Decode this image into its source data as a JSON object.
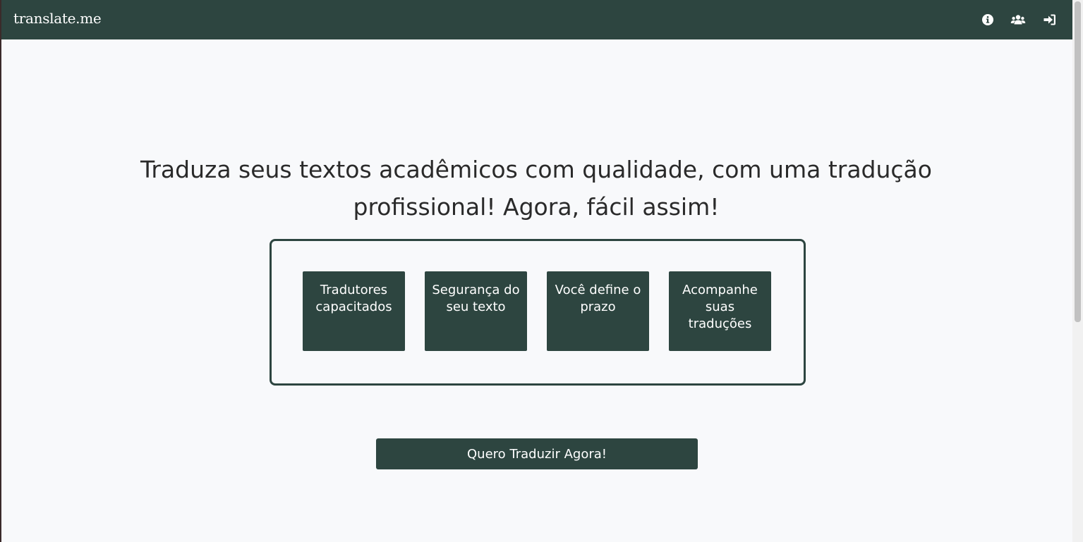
{
  "navbar": {
    "brand": "translate.me",
    "icons": [
      "info-icon",
      "users-icon",
      "sign-in-icon"
    ],
    "background": "#2d4540"
  },
  "hero": {
    "headline": "Traduza seus textos acadêmicos com qualidade, com uma tradução profissional! Agora, fácil assim!"
  },
  "features": [
    {
      "label": "Tradutores capacitados"
    },
    {
      "label": "Segurança do seu texto"
    },
    {
      "label": "Você define o prazo"
    },
    {
      "label": "Acompanhe suas traduções"
    }
  ],
  "cta": {
    "label": "Quero Traduzir Agora!"
  },
  "colors": {
    "accent": "#2d4540",
    "page_background": "#f8f9fb",
    "text": "#2a2a2a"
  }
}
